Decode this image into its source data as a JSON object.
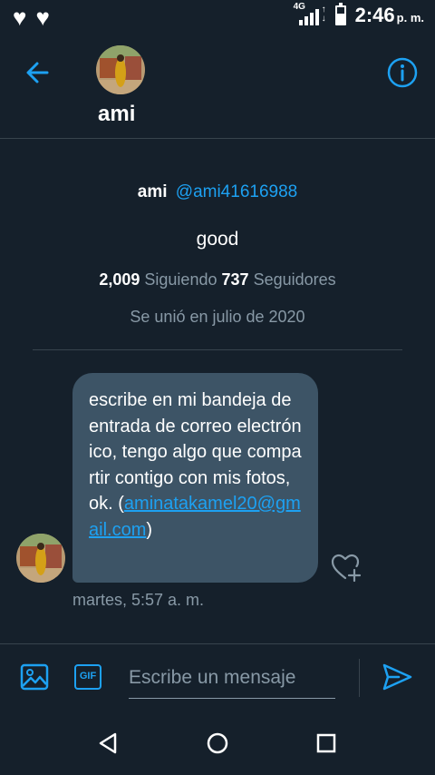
{
  "status_bar": {
    "network": "4G",
    "time": "2:46",
    "ampm": "p. m.",
    "left_icons": [
      "heart-icon",
      "heart-icon"
    ],
    "battery_level": 0.6
  },
  "header": {
    "contact_name": "ami"
  },
  "profile": {
    "name": "ami",
    "handle": "@ami41616988",
    "bio": "good",
    "following_count": "2,009",
    "following_label": "Siguiendo",
    "followers_count": "737",
    "followers_label": "Seguidores",
    "joined": "Se unió en julio de 2020"
  },
  "message": {
    "text": "escribe en mi bandeja de entrada de correo electrónico, tengo algo que compartir contigo con mis fotos, ok. (",
    "email": "aminatakamel20@gmail.com",
    "text_end": ")",
    "timestamp": "martes, 5:57 a. m."
  },
  "composer": {
    "gif_label": "GIF",
    "placeholder": "Escribe un mensaje"
  },
  "colors": {
    "background": "#15202b",
    "accent": "#1da1f2",
    "bubble": "#3d5466",
    "muted_text": "#8899a6",
    "divider": "#38444d"
  }
}
